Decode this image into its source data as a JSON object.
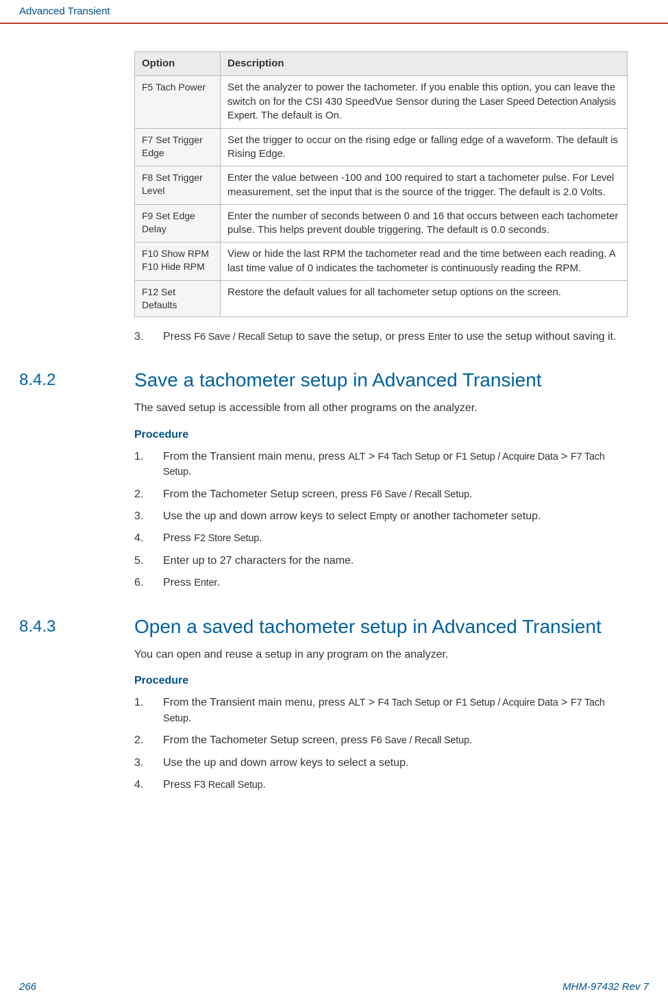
{
  "header": {
    "title": "Advanced Transient"
  },
  "table": {
    "headers": [
      "Option",
      "Description"
    ],
    "rows": [
      {
        "option": "F5 Tach Power",
        "desc_pre": "Set the analyzer to power the tachometer. If you enable this option, you can leave the switch on for the CSI 430 SpeedVue Sensor during the ",
        "desc_mid": "Laser Speed Detection Analysis Expert",
        "desc_post": ". The default is On."
      },
      {
        "option": "F7 Set Trigger Edge",
        "desc": "Set the trigger to occur on the rising edge or falling edge of a waveform. The default is Rising Edge."
      },
      {
        "option": "F8 Set Trigger Level",
        "desc_pre": "Enter the value between -100 and 100 required to start a tachometer pulse. For ",
        "desc_mid": "Level",
        "desc_post": " measurement, set the input that is the source of the trigger. The default is 2.0 Volts."
      },
      {
        "option": "F9 Set Edge Delay",
        "desc": "Enter the number of seconds between 0 and 16 that occurs between each tachometer pulse. This helps prevent double triggering. The default is 0.0 seconds."
      },
      {
        "option_a": "F10 Show RPM",
        "option_b": "F10 Hide RPM",
        "desc": "View or hide the last RPM the tachometer read and the time between each reading. A last time value of 0 indicates the tachometer is continuously reading the RPM."
      },
      {
        "option": "F12 Set Defaults",
        "desc": "Restore the default values for all tachometer setup options on the screen."
      }
    ]
  },
  "step3": {
    "num": "3.",
    "pre": "Press ",
    "a": "F6 Save / Recall Setup",
    "mid": " to save the setup, or press ",
    "b": "Enter",
    "post": " to use the setup without saving it."
  },
  "s842": {
    "num": "8.4.2",
    "title": "Save a tachometer setup in Advanced Transient",
    "intro": "The saved setup is accessible from all other programs on the analyzer.",
    "procedure_label": "Procedure",
    "steps": [
      {
        "n": "1.",
        "pre": "From the Transient main menu, press ",
        "a": "ALT",
        "mid1": " > ",
        "b": "F4 Tach Setup",
        "mid2": " or ",
        "c": "F1 Setup / Acquire Data",
        "mid3": " > ",
        "d": "F7 Tach Setup",
        "post": "."
      },
      {
        "n": "2.",
        "pre": "From the Tachometer Setup screen, press ",
        "a": "F6 Save / Recall Setup",
        "post": "."
      },
      {
        "n": "3.",
        "pre": "Use the up and down arrow keys to select ",
        "a": "Empty",
        "post": " or another tachometer setup."
      },
      {
        "n": "4.",
        "pre": "Press ",
        "a": "F2 Store Setup",
        "post": "."
      },
      {
        "n": "5.",
        "t": "Enter up to 27 characters for the name."
      },
      {
        "n": "6.",
        "pre": "Press ",
        "a": "Enter",
        "post": "."
      }
    ]
  },
  "s843": {
    "num": "8.4.3",
    "title": "Open a saved tachometer setup in Advanced Transient",
    "intro": "You can open and reuse a setup in any program on the analyzer.",
    "procedure_label": "Procedure",
    "steps": [
      {
        "n": "1.",
        "pre": "From the Transient main menu, press ",
        "a": "ALT",
        "mid1": " > ",
        "b": "F4 Tach Setup",
        "mid2": " or ",
        "c": "F1 Setup / Acquire Data",
        "mid3": " > ",
        "d": "F7 Tach Setup",
        "post": "."
      },
      {
        "n": "2.",
        "pre": "From the Tachometer Setup screen, press ",
        "a": "F6 Save / Recall Setup",
        "post": "."
      },
      {
        "n": "3.",
        "t": "Use the up and down arrow keys to select a setup."
      },
      {
        "n": "4.",
        "pre": "Press ",
        "a": "F3 Recall Setup",
        "post": "."
      }
    ]
  },
  "footer": {
    "page": "266",
    "doc": "MHM-97432 Rev 7"
  }
}
